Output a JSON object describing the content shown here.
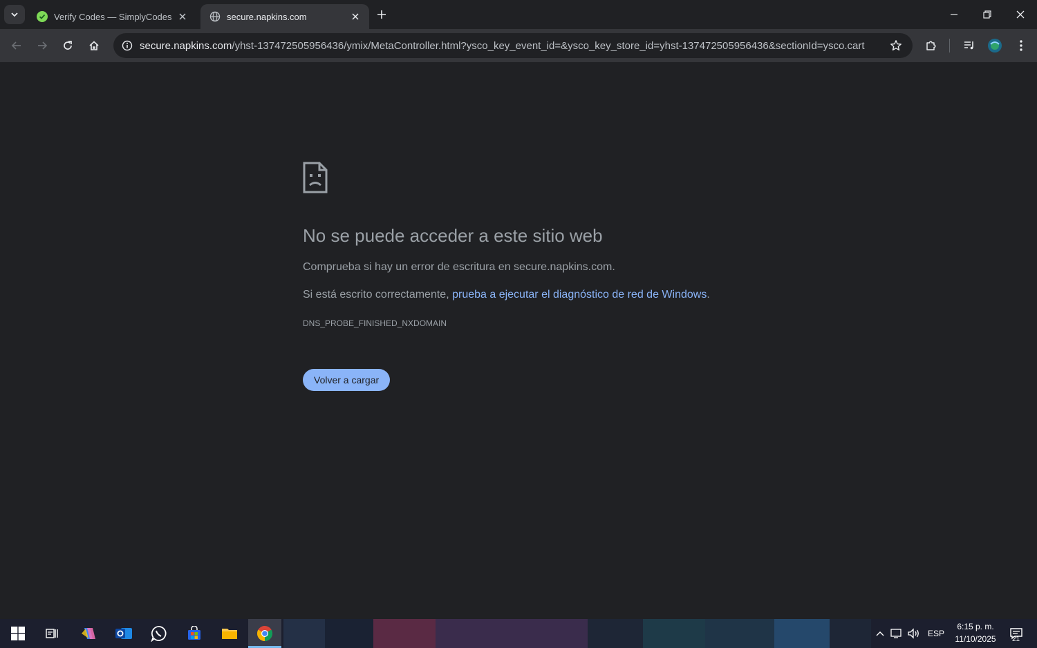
{
  "browser": {
    "tabs": [
      {
        "title": "Verify Codes — SimplyCodes",
        "active": false
      },
      {
        "title": "secure.napkins.com",
        "active": true
      }
    ],
    "url_host": "secure.napkins.com",
    "url_path": "/yhst-137472505956436/ymix/MetaController.html?ysco_key_event_id=&ysco_key_store_id=yhst-137472505956436&sectionId=ysco.cart"
  },
  "error_page": {
    "title": "No se puede acceder a este sitio web",
    "line1": "Comprueba si hay un error de escritura en secure.napkins.com.",
    "line2_prefix": "Si está escrito correctamente, ",
    "line2_link": "prueba a ejecutar el diagnóstico de red de Windows",
    "line2_suffix": ".",
    "error_code": "DNS_PROBE_FINISHED_NXDOMAIN",
    "reload_button": "Volver a cargar"
  },
  "taskbar": {
    "language": "ESP",
    "time": "6:15 p. m.",
    "date": "11/10/2025",
    "notification_count": "21"
  },
  "colors": {
    "accent": "#8ab4f8",
    "page_bg": "#202124",
    "toolbar_bg": "#35363a"
  }
}
